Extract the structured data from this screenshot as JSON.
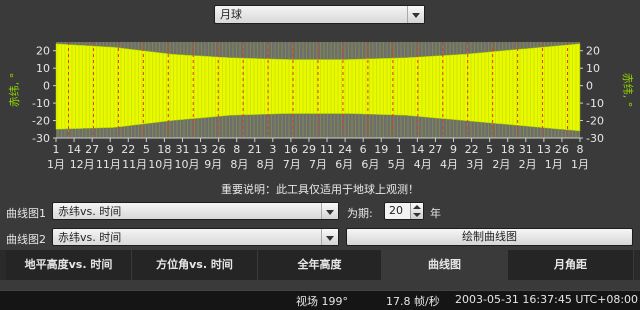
{
  "object_select": {
    "value": "月球"
  },
  "note": "重要说明：此工具仅适用于地球上观测！",
  "plot1": {
    "label": "曲线图1",
    "value": "赤纬vs. 时间"
  },
  "plot2": {
    "label": "曲线图2",
    "value": "赤纬vs. 时间"
  },
  "period": {
    "label": "为期:",
    "value": "20",
    "unit": "年"
  },
  "draw_button": "绘制曲线图",
  "tabs": [
    {
      "label": "地平高度vs. 时间",
      "active": false
    },
    {
      "label": "方位角vs. 时间",
      "active": false
    },
    {
      "label": "全年高度",
      "active": false
    },
    {
      "label": "曲线图",
      "active": true
    },
    {
      "label": "月角距",
      "active": false
    }
  ],
  "status": {
    "fov": "视场 199°",
    "fps": "17.8 帧/秒",
    "datetime": "2003-05-31 16:37:45 UTC+08:00"
  },
  "colors": {
    "panel": "#3a3a3a",
    "plot_bg": "#6e6e6e",
    "fill": "#e9f900",
    "fill_edge": "#9fc400",
    "marker": "#e03a2a",
    "axis_label": "#8fd400"
  },
  "chart_data": {
    "type": "area",
    "ylabel_left": "赤纬, °",
    "ylabel_right": "赤纬, °",
    "ylim": [
      -30,
      25
    ],
    "yticks": [
      20,
      10,
      0,
      -10,
      -20,
      -30
    ],
    "x_tick_labels": [
      "1",
      "14",
      "27",
      "9",
      "22",
      "5",
      "18",
      "31",
      "13",
      "26",
      "8",
      "21",
      "3",
      "16",
      "29",
      "11",
      "24",
      "6",
      "19",
      "1",
      "14",
      "27",
      "9",
      "22",
      "5",
      "18",
      "31",
      "13",
      "26",
      "8"
    ],
    "month_labels": [
      {
        "at": 1,
        "label": "1月"
      },
      {
        "at": 2,
        "label": "12月"
      },
      {
        "at": 3,
        "label": "11月"
      },
      {
        "at": 4,
        "label": "11月"
      },
      {
        "at": 5,
        "label": "10月"
      },
      {
        "at": 6,
        "label": "10月"
      },
      {
        "at": 7,
        "label": "9月"
      },
      {
        "at": 8,
        "label": "8月"
      },
      {
        "at": 9,
        "label": "8月"
      },
      {
        "at": 10,
        "label": "7月"
      },
      {
        "at": 11,
        "label": "7月"
      },
      {
        "at": 12,
        "label": "6月"
      },
      {
        "at": 13,
        "label": "6月"
      },
      {
        "at": 14,
        "label": "5月"
      },
      {
        "at": 15,
        "label": "4月"
      },
      {
        "at": 16,
        "label": "4月"
      },
      {
        "at": 17,
        "label": "3月"
      },
      {
        "at": 18,
        "label": "2月"
      },
      {
        "at": 19,
        "label": "2月"
      },
      {
        "at": 20,
        "label": "1月"
      },
      {
        "at": 21,
        "label": "1月"
      }
    ],
    "series": [
      {
        "upper": [
          24,
          22,
          18,
          16,
          15,
          15,
          16,
          18,
          21,
          24
        ],
        "lower": [
          -25,
          -24,
          -20,
          -17,
          -16,
          -16,
          -17,
          -20,
          -23,
          -26
        ]
      }
    ],
    "marker_count": 21
  }
}
